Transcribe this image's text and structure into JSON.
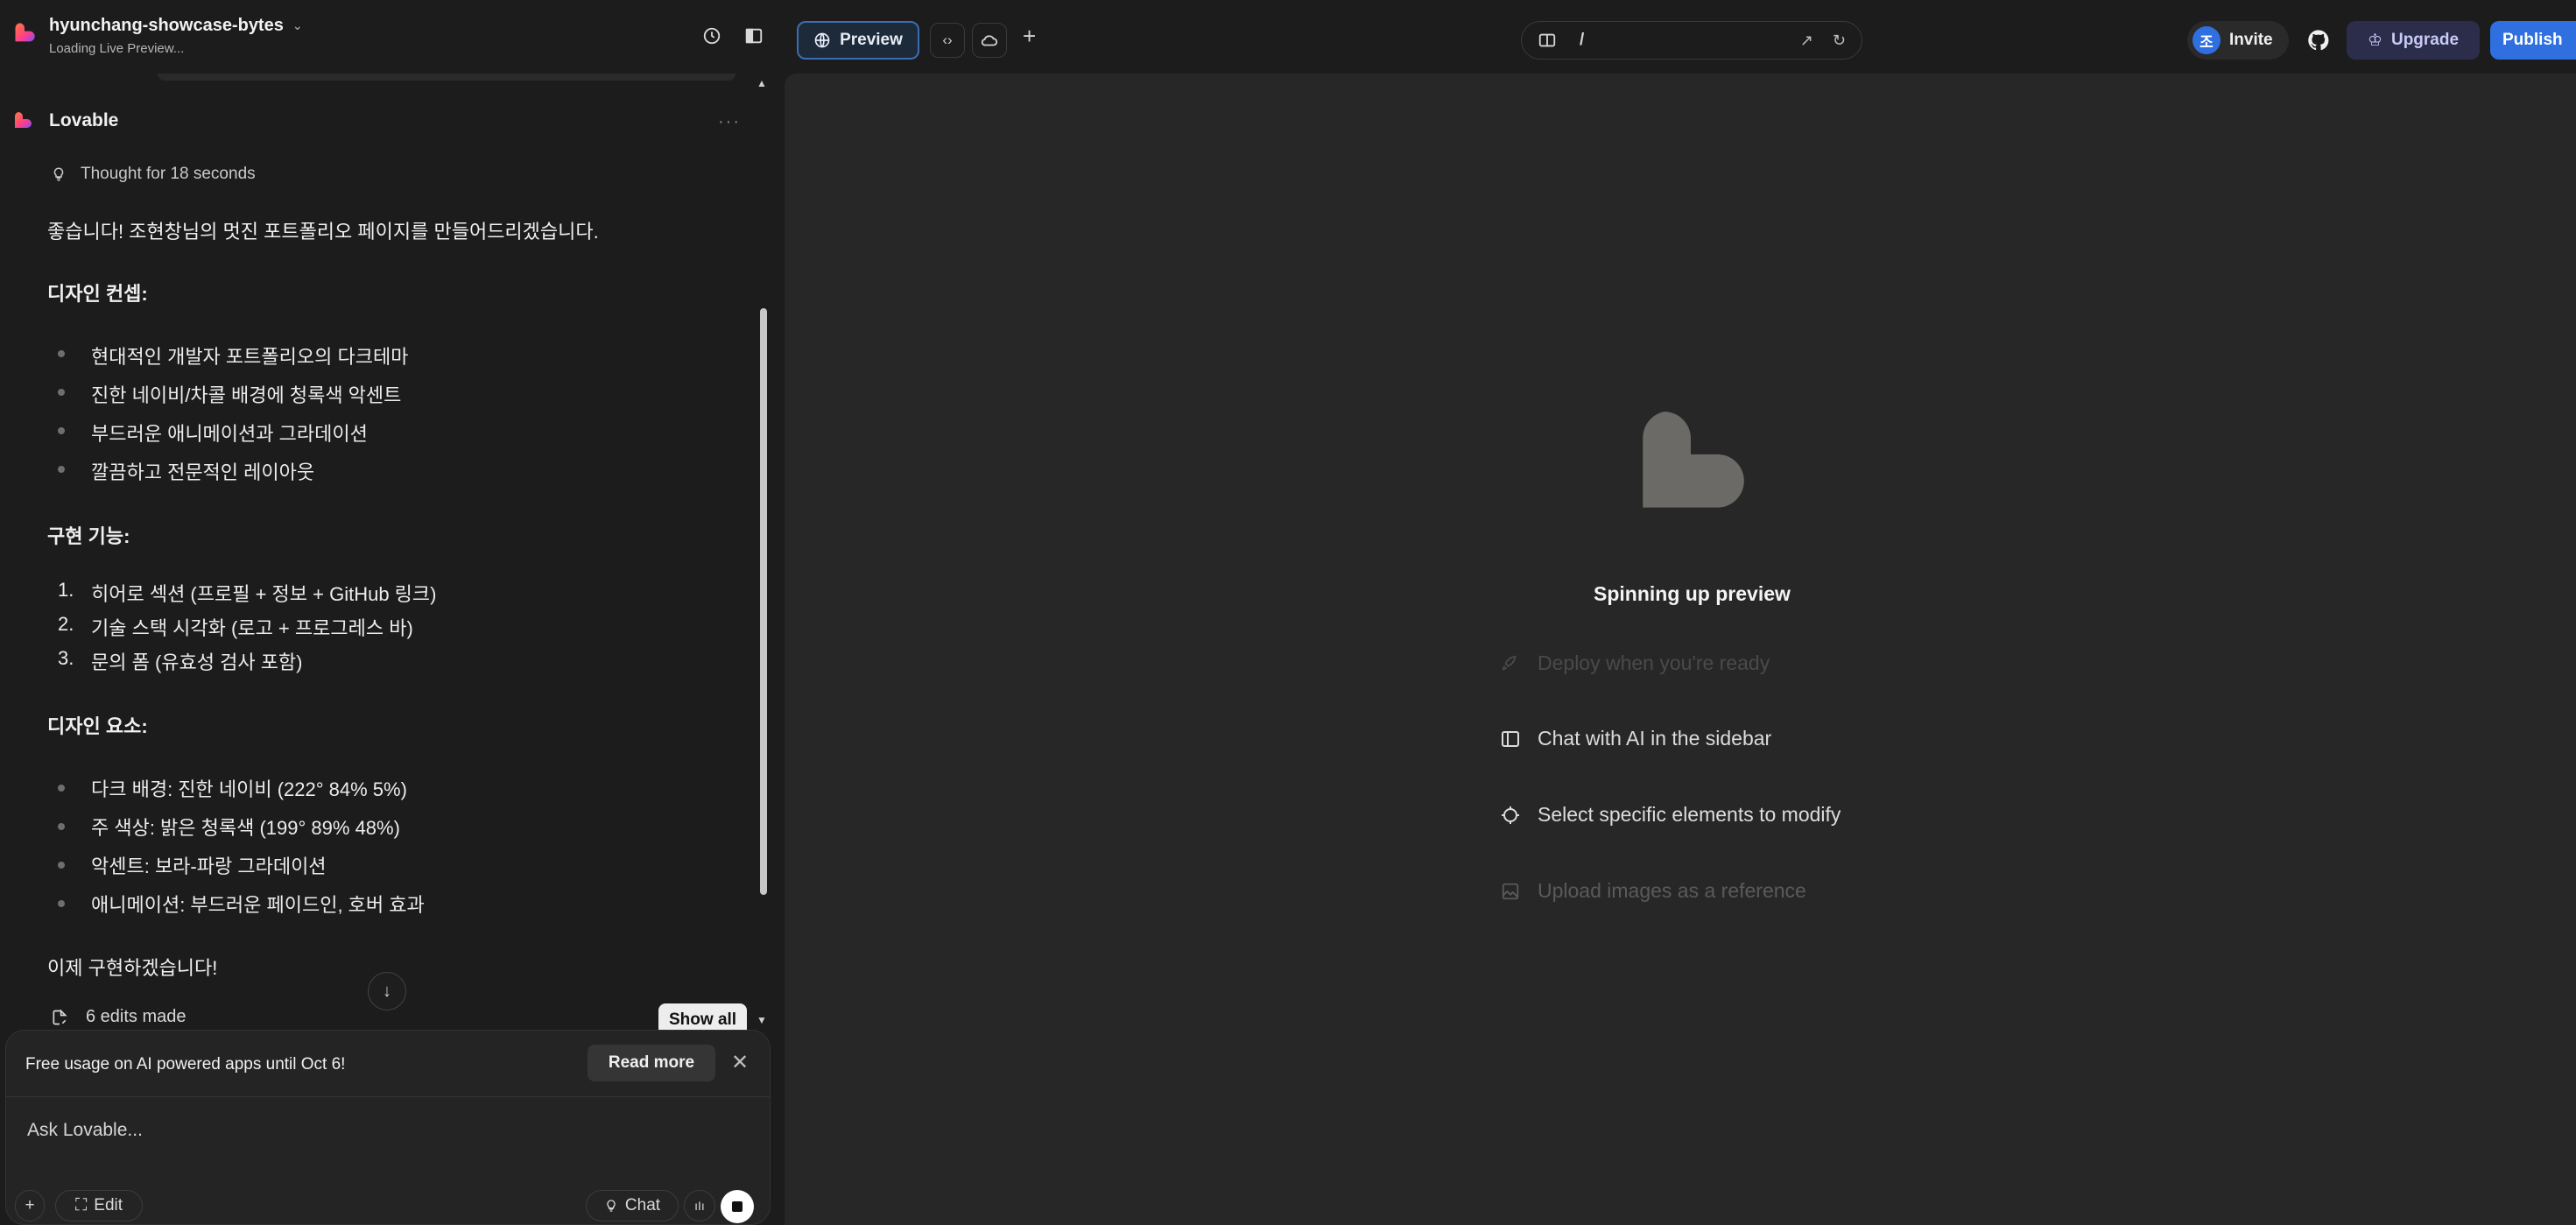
{
  "topbar": {
    "project_name": "hyunchang-showcase-bytes",
    "status": "Loading Live Preview...",
    "preview_label": "Preview",
    "url_path": "/",
    "invite_label": "Invite",
    "avatar_initial": "조",
    "upgrade_label": "Upgrade",
    "publish_label": "Publish",
    "icons": [
      "history-icon",
      "sidebar-toggle-icon",
      "globe-icon",
      "code-icon",
      "cloud-icon",
      "plus-icon",
      "browser-icon",
      "open-external-icon",
      "refresh-icon",
      "github-icon",
      "crown-icon"
    ]
  },
  "chat": {
    "sender": "Lovable",
    "thought": "Thought for 18 seconds",
    "intro": "좋습니다! 조현창님의 멋진 포트폴리오 페이지를 만들어드리겠습니다.",
    "sections": [
      {
        "heading": "디자인 컨셉:",
        "items": [
          "현대적인 개발자 포트폴리오의 다크테마",
          "진한 네이비/차콜 배경에 청록색 악센트",
          "부드러운 애니메이션과 그라데이션",
          "깔끔하고 전문적인 레이아웃"
        ]
      },
      {
        "heading": "구현 기능:",
        "items": [
          "히어로 섹션 (프로필 + 정보 + GitHub 링크)",
          "기술 스택 시각화 (로고 + 프로그레스 바)",
          "문의 폼 (유효성 검사 포함)"
        ],
        "numbers": [
          "1.",
          "2.",
          "3."
        ]
      },
      {
        "heading": "디자인 요소:",
        "items": [
          "다크 배경: 진한 네이비 (222° 84% 5%)",
          "주 색상: 밝은 청록색 (199° 89% 48%)",
          "악센트: 보라-파랑 그라데이션",
          "애니메이션: 부드러운 페이드인, 호버 효과"
        ]
      }
    ],
    "outro": "이제 구현하겠습니다!",
    "edits": "6 edits made",
    "show_all": "Show all"
  },
  "composer": {
    "notice": "Free usage on AI powered apps until Oct 6!",
    "read_more": "Read more",
    "placeholder": "Ask Lovable...",
    "edit_label": "Edit",
    "chat_label": "Chat"
  },
  "preview": {
    "status": "Spinning up preview",
    "tips": [
      "Deploy when you're ready",
      "Chat with AI in the sidebar",
      "Select specific elements to modify",
      "Upload images as a reference"
    ]
  },
  "colors": {
    "accent": "#2f6fe0",
    "brand_gradient": [
      "#ff5a3c",
      "#ff3d8b",
      "#7a4dff"
    ],
    "background": "#1c1c1c",
    "preview_bg": "#272727"
  }
}
